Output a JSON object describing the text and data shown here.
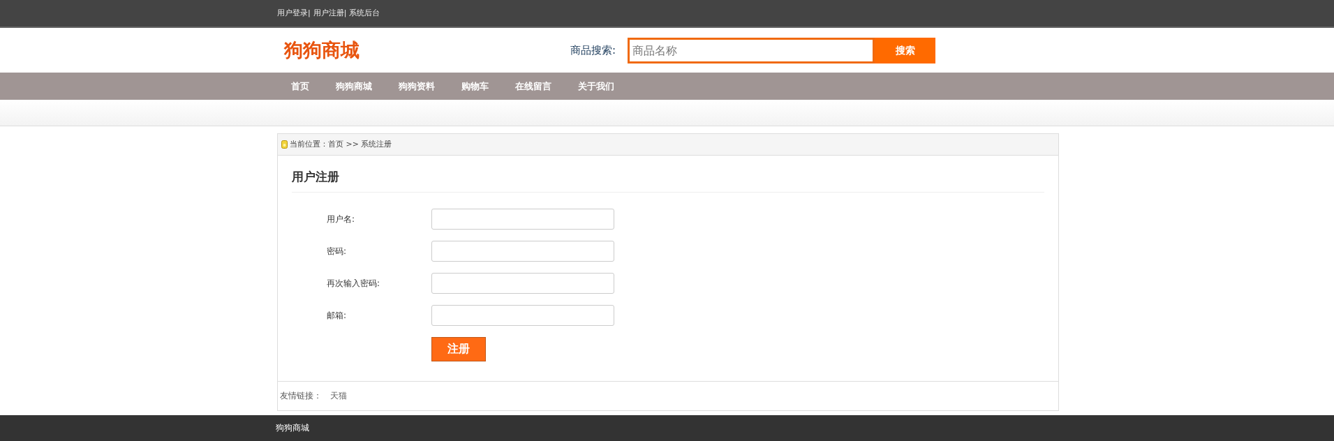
{
  "top_links": [
    "用户登录|",
    "用户注册|",
    "系统后台"
  ],
  "header": {
    "logo": "狗狗商城",
    "search_label": "商品搜索:",
    "search": {
      "placeholder": "商品名称"
    },
    "search_button": "搜索"
  },
  "nav": [
    "首页",
    "狗狗商城",
    "狗狗资料",
    "购物车",
    "在线留言",
    "关于我们"
  ],
  "breadcrumb": "当前位置：首页 >> 系统注册",
  "form": {
    "title": "用户注册",
    "fields": [
      {
        "label": "用户名:"
      },
      {
        "label": "密码:"
      },
      {
        "label": "再次输入密码:"
      },
      {
        "label": "邮箱:"
      }
    ],
    "submit": "注册"
  },
  "friend_links": {
    "label": "友情链接：",
    "links": [
      "天猫"
    ]
  },
  "footer": "狗狗商城"
}
